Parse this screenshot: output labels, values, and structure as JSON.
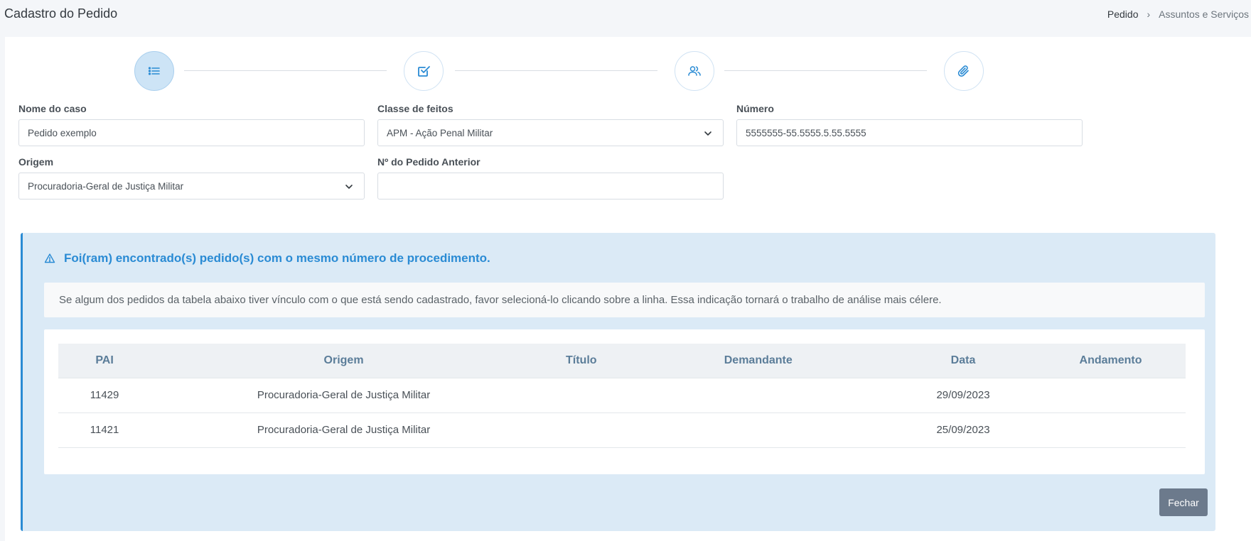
{
  "header": {
    "title": "Cadastro do Pedido",
    "breadcrumb": [
      "Pedido",
      "Assuntos e Serviços"
    ]
  },
  "stepper": {
    "steps": [
      {
        "icon": "list-icon",
        "active": true
      },
      {
        "icon": "checkbox-icon",
        "active": false
      },
      {
        "icon": "users-icon",
        "active": false
      },
      {
        "icon": "paperclip-icon",
        "active": false
      }
    ]
  },
  "form": {
    "nome_label": "Nome do caso",
    "nome_value": "Pedido exemplo",
    "classe_label": "Classe de feitos",
    "classe_value": "APM - Ação Penal Militar",
    "numero_label": "Número",
    "numero_value": "5555555-55.5555.5.55.5555",
    "origem_label": "Origem",
    "origem_value": "Procuradoria-Geral de Justiça Militar",
    "anterior_label": "Nº do Pedido Anterior",
    "anterior_value": ""
  },
  "alert": {
    "title": "Foi(ram) encontrado(s) pedido(s) com o mesmo número de procedimento.",
    "message": "Se algum dos pedidos da tabela abaixo tiver vínculo com o que está sendo cadastrado, favor selecioná-lo clicando sobre a linha. Essa indicação tornará o trabalho de análise mais célere.",
    "table": {
      "columns": [
        "PAI",
        "Origem",
        "Título",
        "Demandante",
        "Data",
        "Andamento"
      ],
      "rows": [
        [
          "11429",
          "Procuradoria-Geral de Justiça Militar",
          "",
          "",
          "29/09/2023",
          ""
        ],
        [
          "11421",
          "Procuradoria-Geral de Justiça Militar",
          "",
          "",
          "25/09/2023",
          ""
        ]
      ]
    },
    "close_label": "Fechar"
  },
  "colors": {
    "accent": "#2a8bd4",
    "alert_bg": "#dbeaf6",
    "button_bg": "#6c7a8c"
  }
}
